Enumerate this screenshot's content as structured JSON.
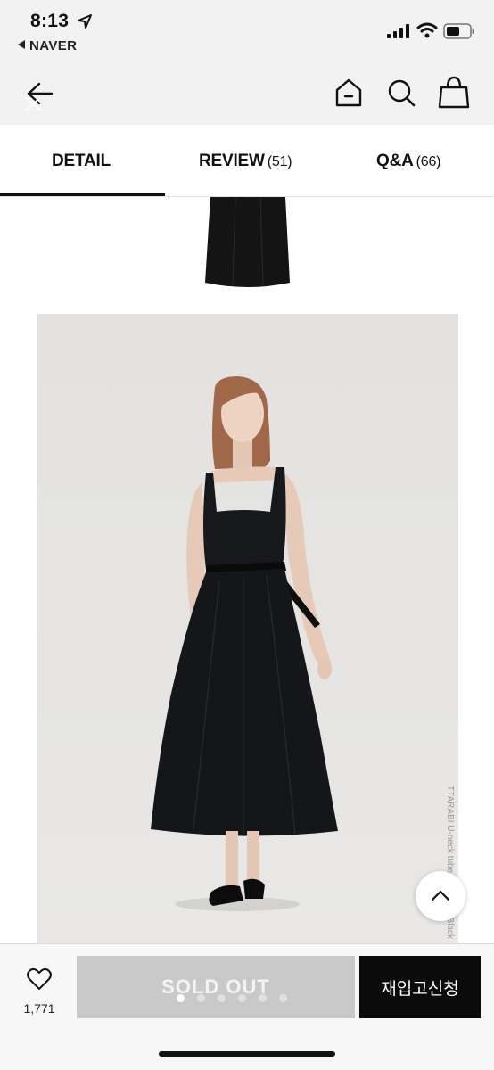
{
  "status_bar": {
    "time": "8:13",
    "back_app_label": "NAVER"
  },
  "top_nav": {
    "icons": [
      "back-arrow-icon",
      "home-icon",
      "search-icon",
      "shopping-bag-icon"
    ]
  },
  "tabs": [
    {
      "label": "DETAIL",
      "count": "",
      "active": true
    },
    {
      "label": "REVIEW",
      "count": "(51)",
      "active": false
    },
    {
      "label": "Q&A",
      "count": "(66)",
      "active": false
    }
  ],
  "product_image": {
    "caption": "TTARABI U-neck tube top dress_Black"
  },
  "bottom_bar": {
    "like_count": "1,771",
    "sold_out_label": "SOLD OUT",
    "restock_label": "재입고신청",
    "carousel_dots": 6,
    "carousel_active_index": 0
  },
  "colors": {
    "accent": "#111111",
    "sold_out_bg": "#c9c9c9",
    "restock_bg": "#0b0b0b"
  }
}
